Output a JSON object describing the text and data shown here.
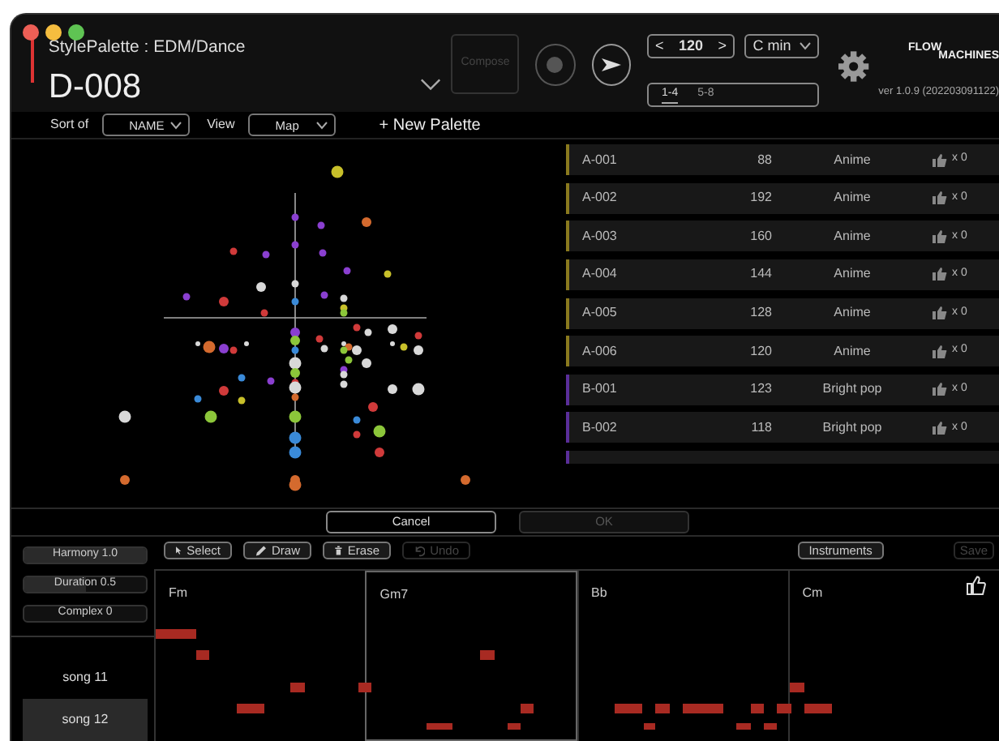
{
  "header": {
    "subtitle": "StylePalette : EDM/Dance",
    "title": "D-008",
    "compose": {
      "label": "Compose",
      "disabled": true
    },
    "tempo": {
      "prev": "<",
      "value": "120",
      "next": ">"
    },
    "key": "C min",
    "pages": [
      {
        "label": "1-4",
        "selected": true
      },
      {
        "label": "5-8",
        "selected": false
      }
    ],
    "brand_top": "FLOW",
    "brand_bottom": "MACHINES",
    "version": "ver 1.0.9 (202203091122)"
  },
  "toolbar": {
    "sort_label": "Sort of",
    "sort_value": "NAME",
    "view_label": "View",
    "view_value": "Map",
    "new_palette": "+ New Palette"
  },
  "palettes": [
    {
      "name": "A-001",
      "bpm": "88",
      "genre": "Anime",
      "likes": "x 0",
      "color": "#8a7a1e"
    },
    {
      "name": "A-002",
      "bpm": "192",
      "genre": "Anime",
      "likes": "x 0",
      "color": "#8a7a1e"
    },
    {
      "name": "A-003",
      "bpm": "160",
      "genre": "Anime",
      "likes": "x 0",
      "color": "#8a7a1e"
    },
    {
      "name": "A-004",
      "bpm": "144",
      "genre": "Anime",
      "likes": "x 0",
      "color": "#8a7a1e"
    },
    {
      "name": "A-005",
      "bpm": "128",
      "genre": "Anime",
      "likes": "x 0",
      "color": "#8a7a1e"
    },
    {
      "name": "A-006",
      "bpm": "120",
      "genre": "Anime",
      "likes": "x 0",
      "color": "#8a7a1e"
    },
    {
      "name": "B-001",
      "bpm": "123",
      "genre": "Bright pop",
      "likes": "x 0",
      "color": "#5a2e9a"
    },
    {
      "name": "B-002",
      "bpm": "118",
      "genre": "Bright pop",
      "likes": "x 0",
      "color": "#5a2e9a"
    }
  ],
  "dialog_buttons": [
    {
      "label": "Cancel",
      "disabled": false
    },
    {
      "label": "OK",
      "disabled": true
    }
  ],
  "parameters": [
    {
      "label": "Harmony 1.0",
      "level": 1
    },
    {
      "label": "Duration 0.5",
      "level": 0.5
    },
    {
      "label": "Complex 0",
      "level": 0
    }
  ],
  "songs": [
    {
      "label": "song 11",
      "selected": false
    },
    {
      "label": "song 12",
      "selected": true
    }
  ],
  "edit_tools": [
    {
      "kind": "select",
      "label": "Select",
      "disabled": false
    },
    {
      "kind": "draw",
      "label": "Draw",
      "disabled": false
    },
    {
      "kind": "erase",
      "label": "Erase",
      "disabled": false
    },
    {
      "kind": "undo",
      "label": "Undo",
      "disabled": true
    }
  ],
  "right_tools": [
    {
      "label": "Instruments",
      "disabled": false
    },
    {
      "label": "Save",
      "disabled": true
    }
  ],
  "chords": [
    {
      "label": "Fm",
      "selected": false
    },
    {
      "label": "Gm7",
      "selected": true
    },
    {
      "label": "Bb",
      "selected": false
    },
    {
      "label": "Cm",
      "selected": false
    }
  ]
}
